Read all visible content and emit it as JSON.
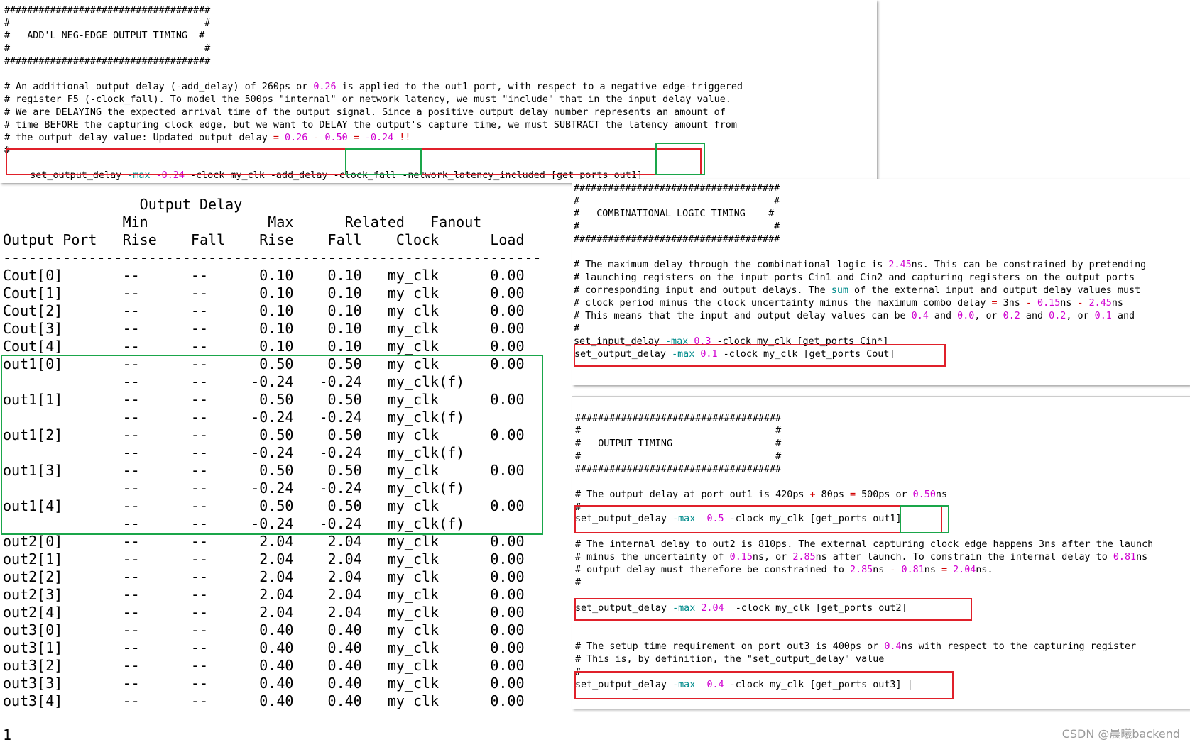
{
  "top_panel": {
    "lines": [
      "####################################",
      "#                                  #",
      "#   ADD'L NEG-EDGE OUTPUT TIMING  #",
      "#                                  #",
      "####################################",
      "",
      "# An additional output delay (-add_delay) of 260ps or 0.26 is applied to the out1 port, with respect to a negative edge-triggered",
      "# register F5 (-clock_fall). To model the 500ps \"internal\" or network latency, we must \"include\" that in the input delay value.",
      "# We are DELAYING the expected arrival time of the output signal. Since a positive output delay number represents an amount of",
      "# time BEFORE the capturing clock edge, but we want to DELAY the output's capture time, we must SUBTRACT the latency amount from",
      "# the output delay value: Updated output delay = 0.26 - 0.50 = -0.24 !!",
      "#"
    ],
    "command": {
      "p1": "set_output_delay ",
      "flag": "-max",
      "p2": " ",
      "val": "-0.24",
      "p3": " -clock my_clk -add_delay ",
      "fall": "-clock_fall",
      "p4": " -network_latency_included [get_ports ",
      "port": "out1]"
    }
  },
  "report": {
    "header_lines": [
      "                Output Delay",
      "              Min              Max      Related   Fanout",
      "Output Port   Rise    Fall    Rise    Fall    Clock      Load",
      "---------------------------------------------------------------"
    ],
    "rows": [
      "Cout[0]       --      --      0.10    0.10   my_clk      0.00",
      "Cout[1]       --      --      0.10    0.10   my_clk      0.00",
      "Cout[2]       --      --      0.10    0.10   my_clk      0.00",
      "Cout[3]       --      --      0.10    0.10   my_clk      0.00",
      "Cout[4]       --      --      0.10    0.10   my_clk      0.00",
      "out1[0]       --      --      0.50    0.50   my_clk      0.00",
      "              --      --     -0.24   -0.24   my_clk(f)",
      "out1[1]       --      --      0.50    0.50   my_clk      0.00",
      "              --      --     -0.24   -0.24   my_clk(f)",
      "out1[2]       --      --      0.50    0.50   my_clk      0.00",
      "              --      --     -0.24   -0.24   my_clk(f)",
      "out1[3]       --      --      0.50    0.50   my_clk      0.00",
      "              --      --     -0.24   -0.24   my_clk(f)",
      "out1[4]       --      --      0.50    0.50   my_clk      0.00",
      "              --      --     -0.24   -0.24   my_clk(f)",
      "out2[0]       --      --      2.04    2.04   my_clk      0.00",
      "out2[1]       --      --      2.04    2.04   my_clk      0.00",
      "out2[2]       --      --      2.04    2.04   my_clk      0.00",
      "out2[3]       --      --      2.04    2.04   my_clk      0.00",
      "out2[4]       --      --      2.04    2.04   my_clk      0.00",
      "out3[0]       --      --      0.40    0.40   my_clk      0.00",
      "out3[1]       --      --      0.40    0.40   my_clk      0.00",
      "out3[2]       --      --      0.40    0.40   my_clk      0.00",
      "out3[3]       --      --      0.40    0.40   my_clk      0.00",
      "out3[4]       --      --      0.40    0.40   my_clk      0.00"
    ],
    "footer": "1"
  },
  "mid_panel": {
    "lines": [
      "####################################",
      "#                                  #",
      "#   COMBINATIONAL LOGIC TIMING    #",
      "#                                  #",
      "####################################",
      "",
      "# The maximum delay through the combinational logic is 2.45ns. This can be constrained by pretending",
      "# launching registers on the input ports Cin1 and Cin2 and capturing registers on the output ports",
      "# corresponding input and output delays. The sum of the external input and output delay values must",
      "# clock period minus the clock uncertainty minus the maximum combo delay = 3ns - 0.15ns - 2.45ns",
      "# This means that the input and output delay values can be 0.4 and 0.0, or 0.2 and 0.2, or 0.1 and",
      "#",
      "set_input_delay -max 0.3 -clock my_clk [get_ports Cin*]"
    ],
    "command": "set_output_delay -max 0.1 -clock my_clk [get_ports Cout]"
  },
  "bottom_panel": {
    "header": [
      "####################################",
      "#                                  #",
      "#   OUTPUT TIMING                  #",
      "#                                  #",
      "####################################",
      "",
      "# The output delay at port out1 is 420ps + 80ps = 500ps or 0.50ns",
      "#"
    ],
    "cmd1": {
      "p1": "set_output_delay ",
      "flag": "-max",
      "p2": "  ",
      "val": "0.5",
      "p3": " -clock my_clk [get_ports ",
      "port": "out1]"
    },
    "mid_lines": [
      "",
      "# The internal delay to out2 is 810ps. The external capturing clock edge happens 3ns after the launch",
      "# minus the uncertainty of 0.15ns, or 2.85ns after launch. To constrain the internal delay to 0.81ns",
      "# output delay must therefore be constrained to 2.85ns - 0.81ns = 2.04ns.",
      "#"
    ],
    "cmd2": "set_output_delay -max 2.04  -clock my_clk [get_ports out2]",
    "end_lines": [
      "",
      "",
      "# The setup time requirement on port out3 is 400ps or 0.4ns with respect to the capturing register",
      "# This is, by definition, the \"set_output_delay\" value",
      "#"
    ],
    "cmd3": "set_output_delay -max  0.4 -clock my_clk [get_ports out3] |"
  },
  "watermark": "CSDN @晨曦backend",
  "colors": {
    "keyword": "#008b8b",
    "number": "#d000d0",
    "operator": "#d00000",
    "red_box": "#e0202a",
    "green_box": "#1aa64a"
  }
}
